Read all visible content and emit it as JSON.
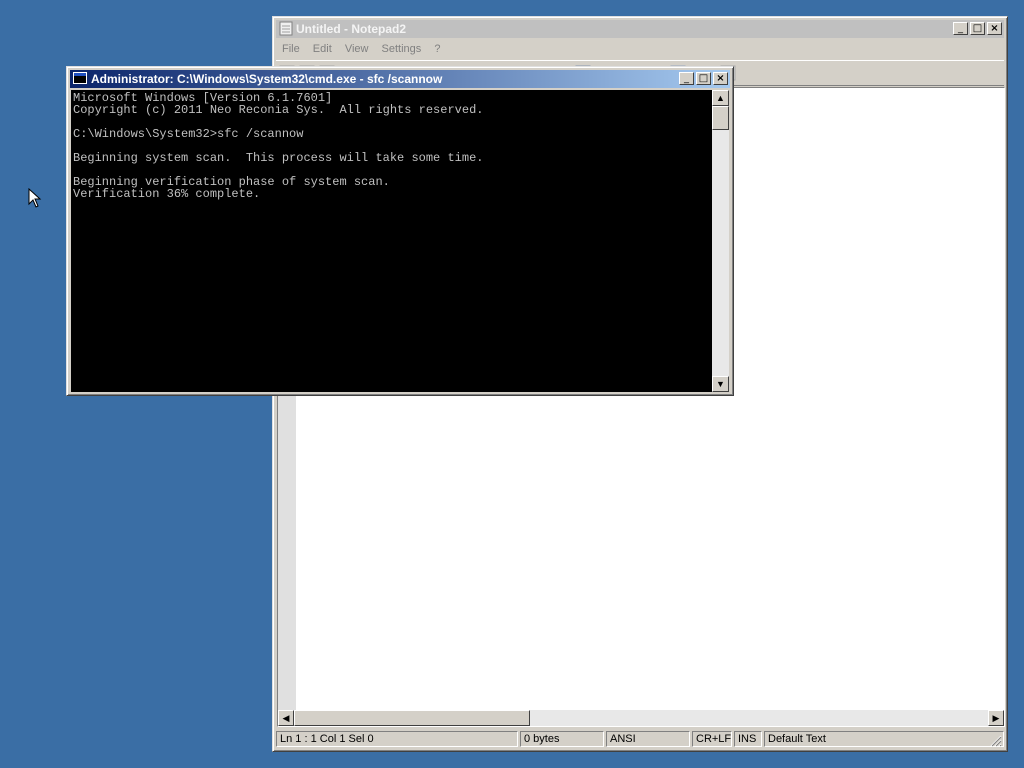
{
  "notepad": {
    "title": "Untitled - Notepad2",
    "menu": [
      "File",
      "Edit",
      "View",
      "Settings",
      "?"
    ],
    "status": {
      "position": "Ln 1 : 1   Col 1   Sel 0",
      "size": "0 bytes",
      "encoding": "ANSI",
      "line_ending": "CR+LF",
      "mode": "INS",
      "scheme": "Default Text"
    }
  },
  "cmd": {
    "title": "Administrator: C:\\Windows\\System32\\cmd.exe - sfc  /scannow",
    "lines": [
      "Microsoft Windows [Version 6.1.7601]",
      "Copyright (c) 2011 Neo Reconia Sys.  All rights reserved.",
      "",
      "C:\\Windows\\System32>sfc /scannow",
      "",
      "Beginning system scan.  This process will take some time.",
      "",
      "Beginning verification phase of system scan.",
      "Verification 36% complete."
    ]
  },
  "colors": {
    "desktop": "#3a6ea5",
    "cmd_title_active": "#0a246a",
    "console_bg": "#000000",
    "console_fg": "#c0c0c0"
  }
}
